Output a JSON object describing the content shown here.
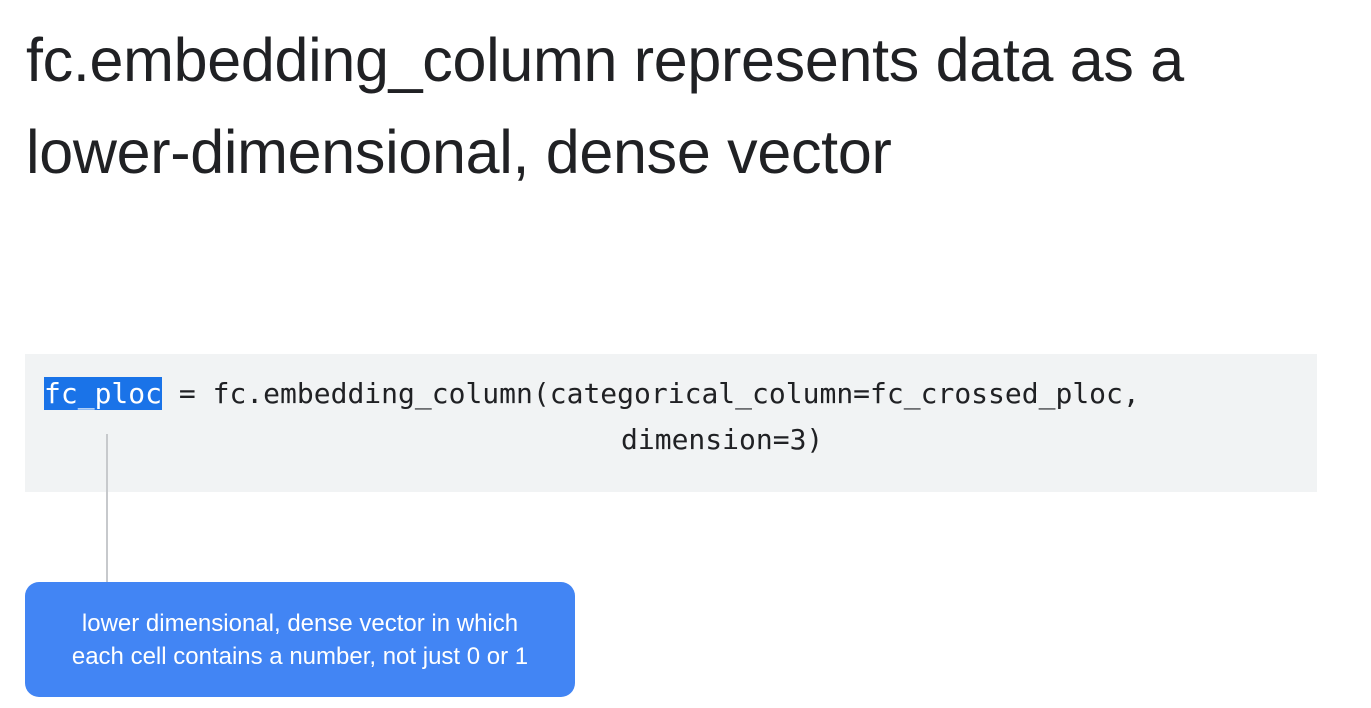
{
  "title": {
    "line1": "fc.embedding_column represents data as a",
    "line2": "lower-dimensional, dense vector"
  },
  "code": {
    "highlighted_var": "fc_ploc",
    "line1_rest": " = fc.embedding_column(categorical_column=fc_crossed_ploc,",
    "line2": "dimension=3)"
  },
  "callout": {
    "line1": "lower dimensional, dense vector in which",
    "line2": "each cell contains a number, not just 0 or 1"
  },
  "colors": {
    "highlight": "#1a73e8",
    "callout_background": "#4285f4",
    "code_background": "#f1f3f4"
  }
}
